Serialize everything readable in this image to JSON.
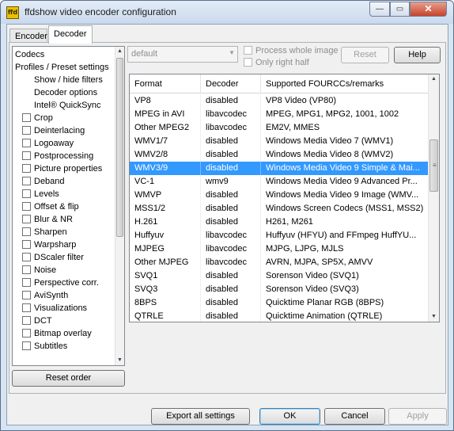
{
  "window": {
    "title": "ffdshow video encoder configuration",
    "icon_text": "ffd",
    "controls": {
      "minimize": "—",
      "maximize": "▭",
      "close": "✕"
    }
  },
  "tabs": [
    {
      "label": "Encoder",
      "active": false
    },
    {
      "label": "Decoder",
      "active": true
    }
  ],
  "tree": {
    "top_items": [
      {
        "label": "Codecs",
        "indent": 0
      },
      {
        "label": "Profiles / Preset settings",
        "indent": 0
      },
      {
        "label": "Show / hide filters",
        "indent": 1
      },
      {
        "label": "Decoder options",
        "indent": 1
      },
      {
        "label": "Intel® QuickSync",
        "indent": 1
      }
    ],
    "filters": [
      "Crop",
      "Deinterlacing",
      "Logoaway",
      "Postprocessing",
      "Picture properties",
      "Deband",
      "Levels",
      "Offset & flip",
      "Blur & NR",
      "Sharpen",
      "Warpsharp",
      "DScaler filter",
      "Noise",
      "Perspective corr.",
      "AviSynth",
      "Visualizations",
      "DCT",
      "Bitmap overlay",
      "Subtitles"
    ]
  },
  "buttons": {
    "reset_order": "Reset order",
    "reset": "Reset",
    "help": "Help",
    "export": "Export all settings",
    "ok": "OK",
    "cancel": "Cancel",
    "apply": "Apply"
  },
  "preset": {
    "value": "default"
  },
  "options": {
    "process_whole_image": "Process whole image",
    "only_right_half": "Only right half"
  },
  "table": {
    "columns": [
      "Format",
      "Decoder",
      "Supported FOURCCs/remarks"
    ],
    "selected_index": 6,
    "rows": [
      [
        "VP8",
        "disabled",
        "VP8 Video (VP80)"
      ],
      [
        "MPEG in AVI",
        "libavcodec",
        "MPEG, MPG1, MPG2, 1001, 1002"
      ],
      [
        "Other MPEG2",
        "libavcodec",
        "EM2V, MMES"
      ],
      [
        "WMV1/7",
        "disabled",
        "Windows Media Video 7 (WMV1)"
      ],
      [
        "WMV2/8",
        "disabled",
        "Windows Media Video 8 (WMV2)"
      ],
      [
        "WMV3/9",
        "disabled",
        "Windows Media Video 9 Simple & Mai..."
      ],
      [
        "VC-1",
        "wmv9",
        "Windows Media Video 9 Advanced Pr..."
      ],
      [
        "WMVP",
        "disabled",
        "Windows Media Video 9 Image (WMV..."
      ],
      [
        "MSS1/2",
        "disabled",
        "Windows Screen Codecs (MSS1, MSS2)"
      ],
      [
        "H.261",
        "disabled",
        "H261, M261"
      ],
      [
        "Huffyuv",
        "libavcodec",
        "Huffyuv (HFYU) and FFmpeg HuffYU..."
      ],
      [
        "MJPEG",
        "libavcodec",
        "MJPG, LJPG, MJLS"
      ],
      [
        "Other MJPEG",
        "libavcodec",
        "AVRN, MJPA, SP5X, AMVV"
      ],
      [
        "SVQ1",
        "disabled",
        "Sorenson Video (SVQ1)"
      ],
      [
        "SVQ3",
        "disabled",
        "Sorenson Video (SVQ3)"
      ],
      [
        "8BPS",
        "disabled",
        "Quicktime Planar RGB (8BPS)"
      ],
      [
        "QTRLE",
        "disabled",
        "Quicktime Animation (QTRLE)"
      ]
    ]
  },
  "colors": {
    "selection": "#3399ff",
    "title_bar": "#c9d9ec",
    "close_button": "#c7432a"
  }
}
